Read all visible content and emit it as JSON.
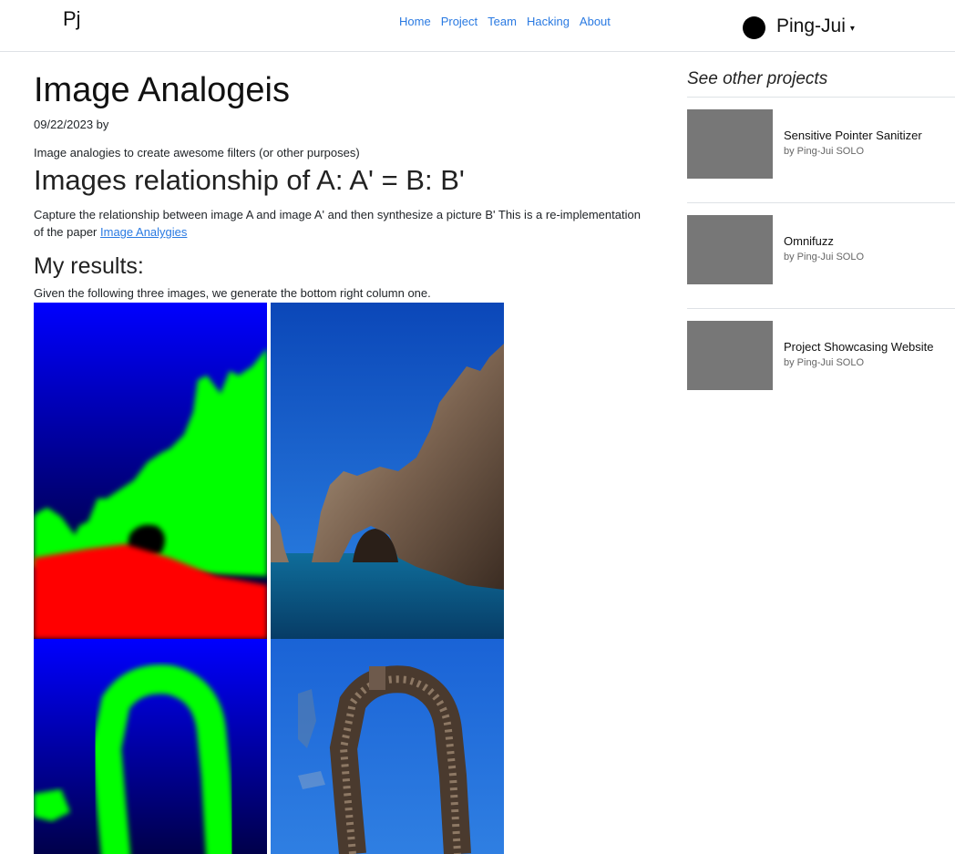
{
  "nav": {
    "brand": "Pj",
    "links": [
      "Home",
      "Project",
      "Team",
      "Hacking",
      "About"
    ],
    "user_name": "Ping-Jui",
    "caret": "▾"
  },
  "article": {
    "title": "Image Analogeis",
    "meta": "09/22/2023 by",
    "subtitle": "Image analogies to create awesome filters (or other purposes)",
    "h2": "Images relationship of A: A' = B: B'",
    "para_text": "Capture the relationship between image A and image A' and then synthesize a picture B' This is a re-implementation of the paper ",
    "para_link": "Image Analygies",
    "h3": "My results:",
    "results_caption": "Given the following three images, we generate the bottom right column one."
  },
  "sidebar": {
    "title": "See other projects",
    "projects": [
      {
        "title": "Sensitive Pointer Sanitizer",
        "by": "by Ping-Jui SOLO"
      },
      {
        "title": "Omnifuzz",
        "by": "by Ping-Jui SOLO"
      },
      {
        "title": "Project Showcasing Website",
        "by": "by Ping-Jui SOLO"
      }
    ]
  },
  "colors": {
    "link": "#2a7ae2",
    "thumb": "#777777",
    "mask_blue": "#0000ff",
    "mask_green": "#00ff00",
    "mask_red": "#ff0000"
  }
}
